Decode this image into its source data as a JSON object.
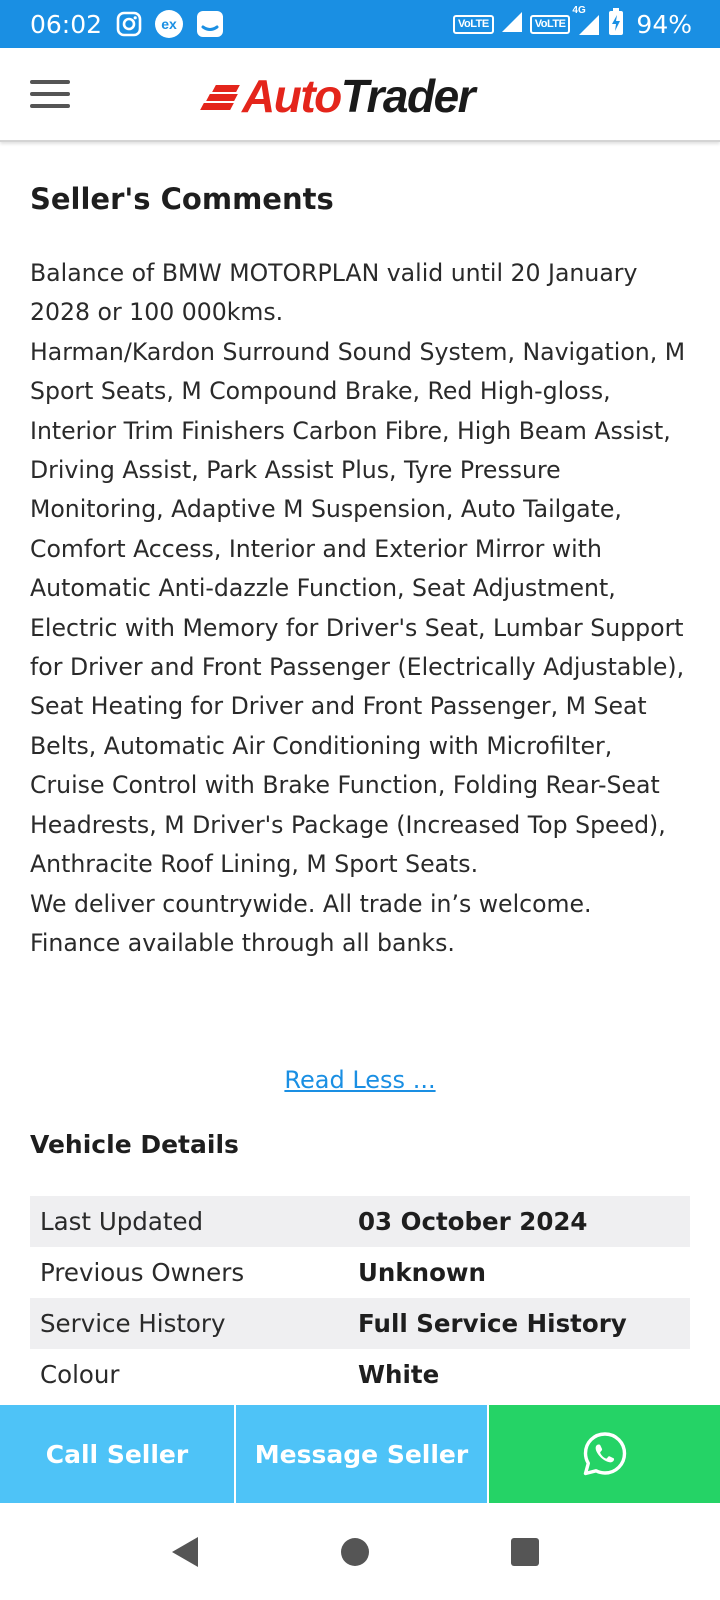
{
  "status_bar": {
    "time": "06:02",
    "volte_1": "VoLTE",
    "volte_2": "VoLTE",
    "network": "4G",
    "battery": "94%"
  },
  "header": {
    "logo_part1": "Auto",
    "logo_part2": "Trader",
    "brand_red": "#e4251b"
  },
  "sellers_comments": {
    "title": "Seller's Comments",
    "paragraphs": [
      "Balance of BMW MOTORPLAN valid until 20 January 2028 or 100 000kms.",
      "Harman/Kardon Surround Sound System, Navigation, M Sport Seats, M Compound Brake, Red High-gloss, Interior Trim Finishers Carbon Fibre, High Beam Assist, Driving Assist, Park Assist Plus, Tyre Pressure Monitoring, Adaptive M Suspension, Auto Tailgate, Comfort Access, Interior and Exterior Mirror with Automatic Anti-dazzle Function, Seat Adjustment, Electric with Memory for Driver's Seat, Lumbar Support for Driver and Front Passenger (Electrically Adjustable), Seat Heating for Driver and Front Passenger, M Seat Belts, Automatic Air Conditioning with Microfilter, Cruise Control with Brake Function, Folding Rear-Seat Headrests, M Driver's Package (Increased Top Speed), Anthracite Roof Lining, M Sport Seats.",
      "We deliver countrywide. All trade in’s welcome.",
      "Finance available through all banks."
    ],
    "read_less": "Read Less ..."
  },
  "vehicle_details": {
    "title": "Vehicle Details",
    "rows": [
      {
        "label": "Last Updated",
        "value": "03 October 2024"
      },
      {
        "label": "Previous Owners",
        "value": "Unknown"
      },
      {
        "label": "Service History",
        "value": "Full Service History"
      },
      {
        "label": "Colour",
        "value": "White"
      }
    ]
  },
  "actions": {
    "call": "Call Seller",
    "message": "Message Seller",
    "whatsapp_color": "#25d366",
    "button_color": "#4ec3f7"
  }
}
